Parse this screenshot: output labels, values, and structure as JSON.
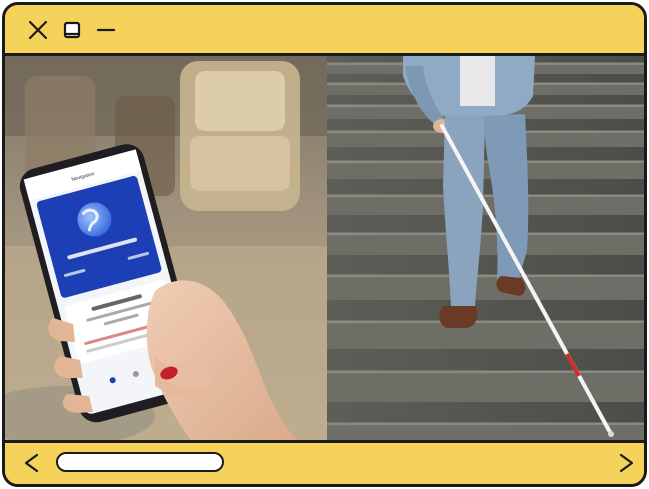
{
  "window": {
    "controls": [
      "close",
      "maximize",
      "minimize"
    ]
  },
  "content": {
    "left_scene": "hand-holding-phone-with-navigation-app",
    "right_scene": "person-with-white-cane-descending-stairs"
  },
  "scrollbar": {
    "left_arrow_icon": "chevron-left-icon",
    "right_arrow_icon": "chevron-right-icon"
  },
  "colors": {
    "window_frame": "#f5d35a",
    "border": "#1a1a1a",
    "app_blue": "#1d3fb5"
  }
}
